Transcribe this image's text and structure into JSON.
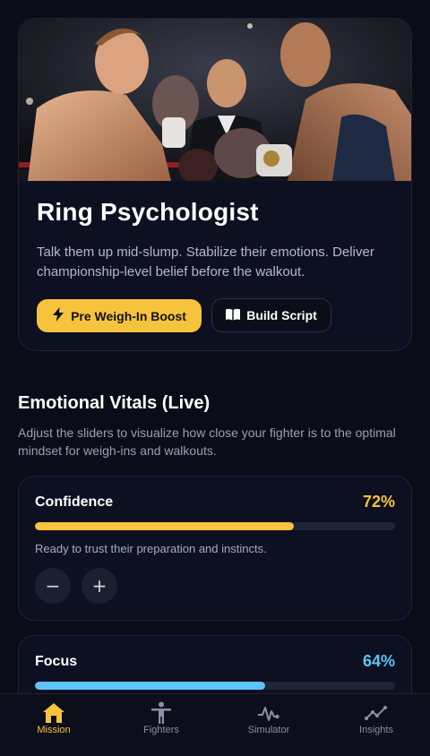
{
  "hero": {
    "image_alt": "boxers face off with referee",
    "title": "Ring Psychologist",
    "description": "Talk them up mid-slump. Stabilize their emotions. Deliver championship-level belief before the walkout.",
    "primary_button": {
      "label": "Pre Weigh-In Boost",
      "icon": "lightning-icon"
    },
    "secondary_button": {
      "label": "Build Script",
      "icon": "book-icon"
    }
  },
  "vitals_section": {
    "title": "Emotional Vitals (Live)",
    "description": "Adjust the sliders to visualize how close your fighter is to the optimal mindset for weigh-ins and walkouts.",
    "items": [
      {
        "name": "Confidence",
        "percent_label": "72%",
        "percent": 72,
        "color": "#f7c33c",
        "note": "Ready to trust their preparation and instincts.",
        "decrease": "−",
        "increase": "+"
      },
      {
        "name": "Focus",
        "percent_label": "64%",
        "percent": 64,
        "color": "#5cc4f7"
      }
    ]
  },
  "nav": {
    "items": [
      {
        "label": "Mission",
        "icon": "home-icon",
        "active": true
      },
      {
        "label": "Fighters",
        "icon": "person-icon",
        "active": false
      },
      {
        "label": "Simulator",
        "icon": "pulse-icon",
        "active": false
      },
      {
        "label": "Insights",
        "icon": "trend-icon",
        "active": false
      }
    ]
  },
  "colors": {
    "accent": "#f7c33c",
    "secondary_accent": "#5cc4f7",
    "background": "#0a0c17",
    "card": "#0d1020"
  }
}
